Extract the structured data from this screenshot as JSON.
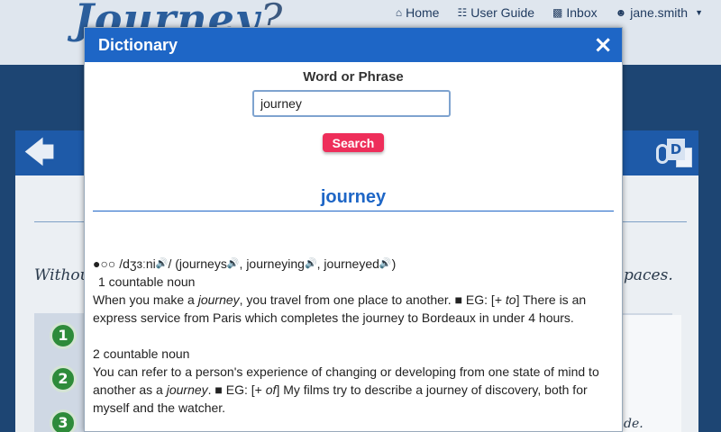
{
  "app": {
    "logo_text": "Journey",
    "logo_mark": "?"
  },
  "topnav": {
    "home": "Home",
    "user_guide": "User Guide",
    "inbox": "Inbox",
    "user": "jane.smith"
  },
  "background": {
    "left_text": "Without",
    "right_text": "paces.",
    "small_text": "de.",
    "steps": [
      "1",
      "2",
      "3"
    ]
  },
  "dictionary": {
    "title": "Dictionary",
    "close_icon": "×",
    "search_label": "Word or Phrase",
    "search_value": "journey",
    "search_button": "Search",
    "headword": "journey",
    "pron_prefix": "●○○ /dʒɜːni",
    "pron_suffix": "/ (journeys",
    "form_2": ", journeying",
    "form_3": ", journeyed",
    "form_end": ")",
    "sense1_label": "1 countable noun",
    "sense1_a": "When you make a ",
    "sense1_b": "journey",
    "sense1_c": ", you travel from one place to another. ■ EG: [+ ",
    "sense1_d": "to",
    "sense1_e": "] There is an express service from Paris which completes the journey to Bordeaux in under 4 hours.",
    "sense2_label": "2 countable noun",
    "sense2_a": "You can refer to a person's experience of changing or developing from one state of mind to another as a ",
    "sense2_b": "journey",
    "sense2_c": ". ■ EG: [+ ",
    "sense2_d": "of",
    "sense2_e": "] My films try to describe a journey of discovery, both for myself and the watcher."
  },
  "colors": {
    "header_blue": "#1e66c6",
    "search_red": "#ee2e5a",
    "speaker_red": "#c8102e",
    "step_green": "#2e8b3a"
  }
}
